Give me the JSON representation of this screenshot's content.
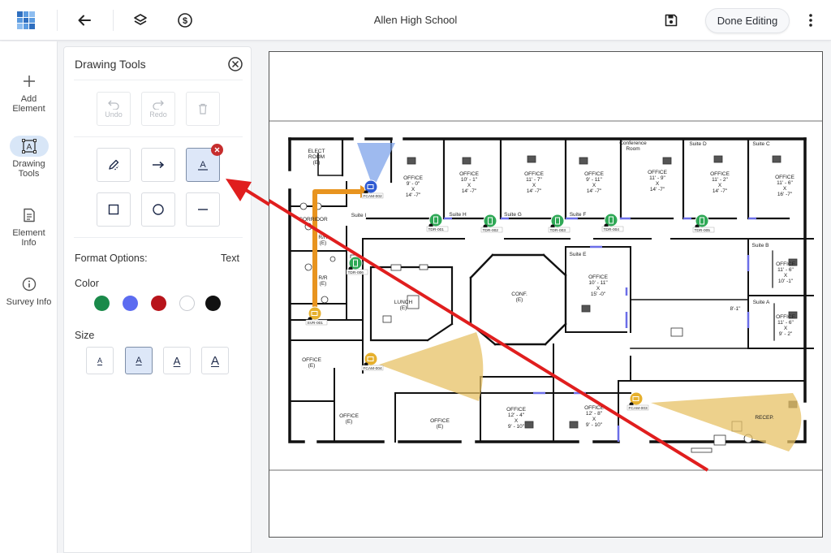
{
  "header": {
    "title": "Allen High School",
    "done_label": "Done Editing"
  },
  "rail": {
    "items": [
      {
        "label": "Add\nElement"
      },
      {
        "label": "Drawing\nTools"
      },
      {
        "label": "Element\nInfo"
      },
      {
        "label": "Survey Info"
      }
    ]
  },
  "panel": {
    "title": "Drawing Tools",
    "undo_label": "Undo",
    "redo_label": "Redo",
    "format_options_label": "Format Options:",
    "format_options_value": "Text",
    "color_label": "Color",
    "size_label": "Size",
    "size_glyph": "A",
    "colors": [
      "#1a8a4a",
      "#5c6cf0",
      "#b8141b",
      "#ffffff",
      "#111111"
    ],
    "selected_size_index": 1
  },
  "floorplan": {
    "rooms": [
      {
        "id": "elect",
        "text": "ELECT\nROOM\n(E)"
      },
      {
        "id": "suite-i",
        "text": "Suite I"
      },
      {
        "id": "off-1",
        "text": "OFFICE\n9' - 0\"\nX\n14' -7\""
      },
      {
        "id": "off-2",
        "text": "OFFICE\n10' - 1\"\nX\n14' -7\""
      },
      {
        "id": "off-3",
        "text": "OFFICE\n11' - 7\"\nX\n14' -7\""
      },
      {
        "id": "off-4",
        "text": "OFFICE\n9' - 11\"\nX\n14' -7\""
      },
      {
        "id": "off-5",
        "text": "OFFICE\n11' - 9\"\nX\n14' -7\""
      },
      {
        "id": "off-6",
        "text": "OFFICE\n11' - 2\"\nX\n14' -7\""
      },
      {
        "id": "off-7",
        "text": "OFFICE\n11' - 6\"\nX\n16' -7\""
      },
      {
        "id": "suite-h",
        "text": "Suite H"
      },
      {
        "id": "suite-g",
        "text": "Suite G"
      },
      {
        "id": "suite-f",
        "text": "Suite F"
      },
      {
        "id": "conf-room",
        "text": "Conference\nRoom"
      },
      {
        "id": "suite-d",
        "text": "Suite D"
      },
      {
        "id": "suite-c",
        "text": "Suite C"
      },
      {
        "id": "corridor",
        "text": "CORRIDOR"
      },
      {
        "id": "rr1",
        "text": "R/R\n(E)"
      },
      {
        "id": "rr2",
        "text": "R/R\n(E)"
      },
      {
        "id": "lunch",
        "text": "LUNCH\n(E)"
      },
      {
        "id": "conf",
        "text": "CONF.\n(E)"
      },
      {
        "id": "suite-e",
        "text": "Suite E"
      },
      {
        "id": "off-8",
        "text": "OFFICE\n10' - 11\"\nX\n15' -0\""
      },
      {
        "id": "suite-b",
        "text": "Suite B"
      },
      {
        "id": "off-9",
        "text": "OFFICE\n11' - 6\"\nX\n10' -1\""
      },
      {
        "id": "suite-a",
        "text": "Suite A"
      },
      {
        "id": "off-10",
        "text": "OFFICE\n11' - 6\"\nX\n9' - 2\""
      },
      {
        "id": "off-e1",
        "text": "OFFICE\n(E)"
      },
      {
        "id": "off-e2",
        "text": "OFFICE\n(E)"
      },
      {
        "id": "off-e3",
        "text": "OFFICE\n(E)"
      },
      {
        "id": "off-11",
        "text": "OFFICE\n12' - 4\"\nX\n9' - 10\""
      },
      {
        "id": "off-12",
        "text": "OFFICE\n12' - 8\"\nX\n9' - 10\""
      },
      {
        "id": "recep",
        "text": "RECEP."
      },
      {
        "id": "dim",
        "text": "8'-1\""
      }
    ],
    "devices": [
      {
        "id": "fcam-002",
        "text": "FCAM-002",
        "type": "camera",
        "color": "#2f5bd3"
      },
      {
        "id": "fcam-004",
        "text": "FCAM-004",
        "type": "camera",
        "color": "#e6b02e"
      },
      {
        "id": "fcam-003",
        "text": "FCAM-003",
        "type": "camera",
        "color": "#e6b02e"
      },
      {
        "id": "svr-001",
        "text": "SVR-001",
        "type": "server",
        "color": "#e6b02e"
      },
      {
        "id": "tdr-001",
        "text": "TDR-001",
        "type": "door",
        "color": "#2fa856"
      },
      {
        "id": "tdr-002",
        "text": "TDR-002",
        "type": "door",
        "color": "#2fa856"
      },
      {
        "id": "tdr-003",
        "text": "TDR-003",
        "type": "door",
        "color": "#2fa856"
      },
      {
        "id": "tdr-004",
        "text": "TDR-004",
        "type": "door",
        "color": "#2fa856"
      },
      {
        "id": "tdr-005",
        "text": "TDR-005",
        "type": "door",
        "color": "#2fa856"
      },
      {
        "id": "tdr-006",
        "text": "TDR-006",
        "type": "door",
        "color": "#2fa856"
      }
    ],
    "annotation_arrow_color": "#e01e1e",
    "cable_color": "#e8941f"
  }
}
